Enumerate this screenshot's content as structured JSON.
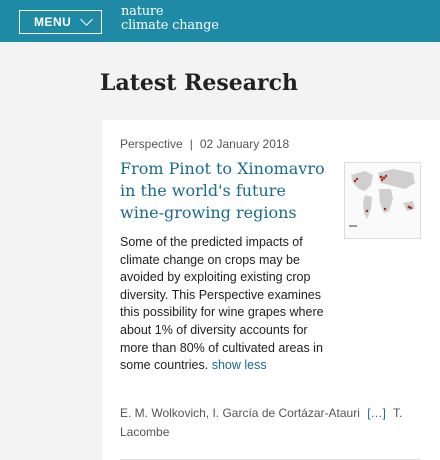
{
  "header": {
    "menu_label": "MENU",
    "brand_line1": "nature",
    "brand_line2": "climate change"
  },
  "section": {
    "title": "Latest Research"
  },
  "article": {
    "type": "Perspective",
    "separator": "|",
    "date": "02 January 2018",
    "title": "From Pinot to Xinomavro in the world's future wine-growing regions",
    "abstract": "Some of the predicted impacts of climate change on crops may be avoided by exploiting existing crop diversity. This Perspective examines this possibility for wine grapes where about 1% of diversity accounts for more than 80% of cultivated areas in some countries.",
    "show_less_label": "show less",
    "authors_part1": "E. M. Wolkovich, I. García de Cortázar-Atauri",
    "authors_more": "[…]",
    "authors_part2": "T. Lacombe",
    "thumbnail_icon": "world-map-thumbnail"
  },
  "colors": {
    "topbar": "#1f8aa5",
    "link": "#1a6a8d",
    "background": "#f3f3f3"
  }
}
